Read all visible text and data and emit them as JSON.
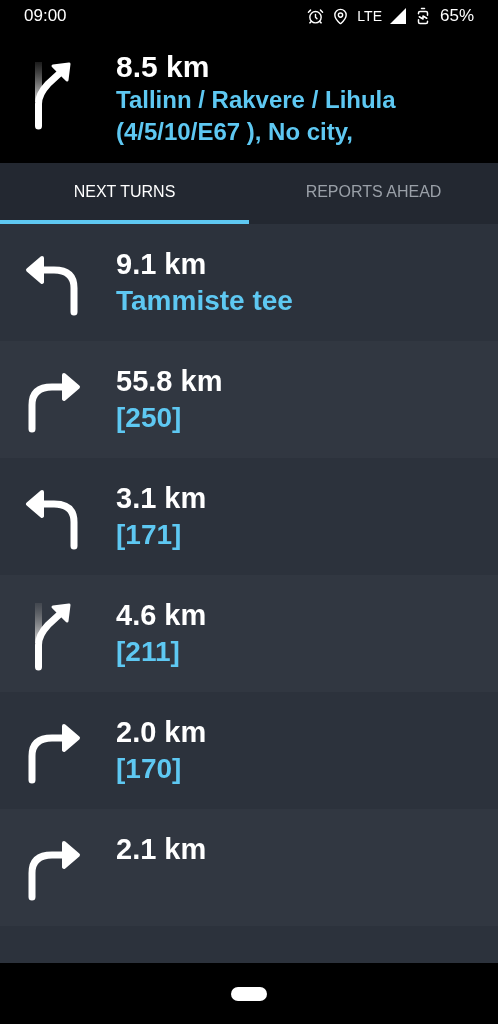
{
  "status_bar": {
    "time": "09:00",
    "network": "LTE",
    "battery": "65%"
  },
  "current": {
    "kind": "slight-right",
    "distance": "8.5 km",
    "street": "Tallinn / Rakvere / Lihula (4/5/10/E67 ), No city,"
  },
  "tabs": [
    {
      "label": "NEXT TURNS",
      "selected": true
    },
    {
      "label": "REPORTS AHEAD",
      "selected": false
    }
  ],
  "turns": [
    {
      "kind": "left",
      "distance": "9.1 km",
      "street": "Tammiste tee"
    },
    {
      "kind": "right",
      "distance": "55.8 km",
      "street": "[250]"
    },
    {
      "kind": "left",
      "distance": "3.1 km",
      "street": "[171]"
    },
    {
      "kind": "slight-right",
      "distance": "4.6 km",
      "street": "[211]"
    },
    {
      "kind": "right",
      "distance": "2.0 km",
      "street": "[170]"
    },
    {
      "kind": "right",
      "distance": "2.1 km"
    }
  ]
}
